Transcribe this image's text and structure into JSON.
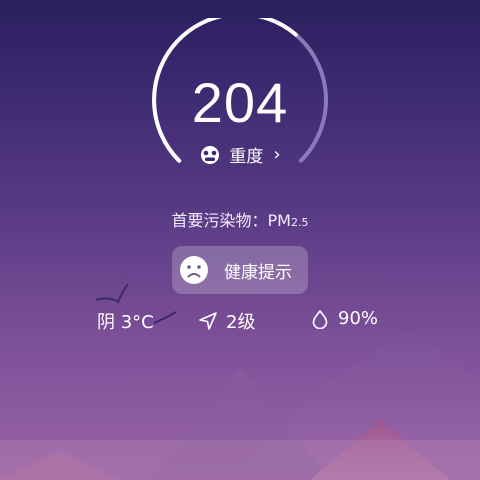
{
  "aqi": {
    "value": "204",
    "level": "重度",
    "progress": 0.65
  },
  "pollutant": {
    "label": "首要污染物：",
    "name": "PM",
    "subscript": "2.5"
  },
  "health": {
    "label": "健康提示"
  },
  "weather": {
    "condition_temp": "阴 3°C",
    "wind": "2级",
    "humidity": "90%"
  },
  "icons": {
    "level": "mask-icon",
    "health": "sad-face-icon",
    "wind": "navigation-arrow-icon",
    "humidity": "water-drop-icon"
  },
  "colors": {
    "accent": "#ffffff",
    "gauge_track": "#8a7bb8"
  }
}
